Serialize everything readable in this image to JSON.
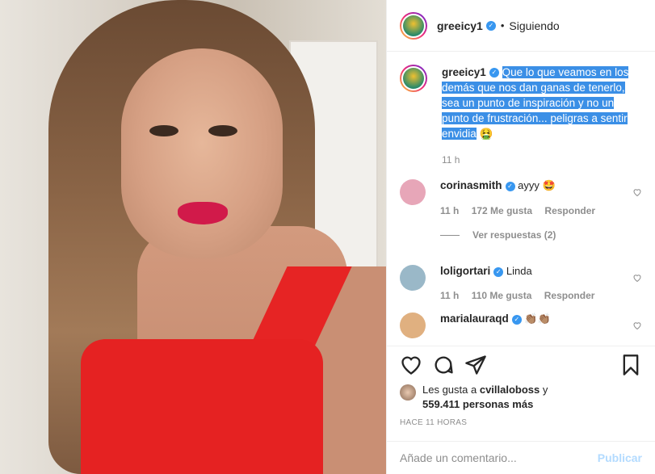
{
  "post": {
    "author": "greeicy1",
    "separator": "•",
    "follow_status": "Siguiendo",
    "caption_author": "greeicy1",
    "caption": "Que lo que veamos en los demás que nos dan ganas de tenerlo, sea un punto de inspiración y no un punto de frustración... peligras a sentir envidia",
    "caption_emoji": "🤮",
    "caption_time": "11 h"
  },
  "comments": [
    {
      "user": "corinasmith",
      "text": "ayyy",
      "emoji": "🤩",
      "time": "11 h",
      "likes": "172 Me gusta",
      "reply": "Responder",
      "view_replies": "Ver respuestas (2)",
      "avatar_color": "#e7a6b8"
    },
    {
      "user": "loligortari",
      "text": "Linda",
      "time": "11 h",
      "likes": "110 Me gusta",
      "reply": "Responder",
      "avatar_color": "#9ab8c8"
    },
    {
      "user": "marialauraqd",
      "text": "👏🏽👏🏽",
      "avatar_color": "#e0b080"
    }
  ],
  "likes": {
    "prefix": "Les gusta a",
    "user": "cvillaloboss",
    "suffix": "y",
    "count": "559.411 personas más"
  },
  "time_ago": "HACE 11 HORAS",
  "comment_box": {
    "placeholder": "Añade un comentario...",
    "submit": "Publicar"
  },
  "colors": {
    "accent": "#3897f0",
    "selection": "#3b8fe6",
    "publish_disabled": "#b3dbff"
  }
}
